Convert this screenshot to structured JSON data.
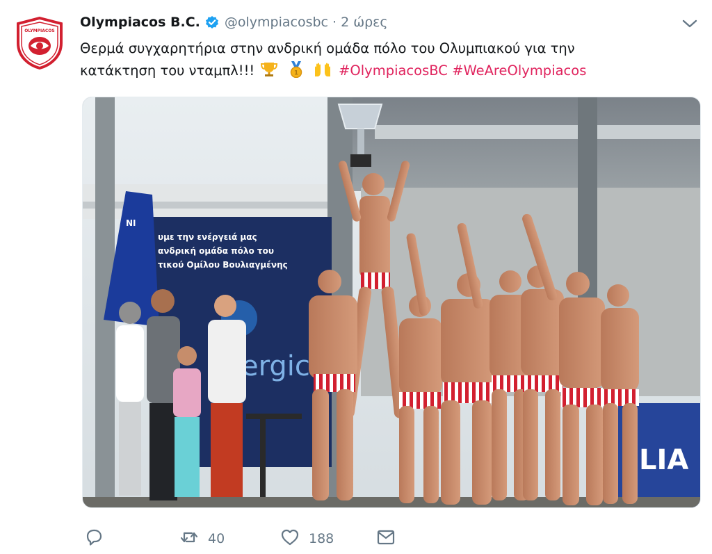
{
  "tweet": {
    "display_name": "Olympiacos B.C.",
    "handle": "@olympiacosbc",
    "separator": "·",
    "time": "2 ώρες",
    "text_line1": "Θερμά συγχαρητήρια στην ανδρική ομάδα πόλο του Ολυμπιακού για την",
    "text_line2": "κατάκτηση του νταμπλ!!!",
    "emojis": [
      "trophy-emoji",
      "gold-medal-emoji",
      "raised-hands-emoji"
    ],
    "hashtags": [
      "#OlympiacosBC",
      "#WeAreOlympiacos"
    ]
  },
  "photo": {
    "banner_line1": "υμε την ενέργειά μας",
    "banner_line2": "ανδρική ομάδα πόλο του",
    "banner_line3": "τικού Ομίλου Βουλιαγμένης",
    "banner_brand": "ergic",
    "board_text": "LIA",
    "board_left_text": "NI"
  },
  "actions": {
    "reply_icon": "reply-icon",
    "retweet_count": "40",
    "like_count": "188",
    "dm_icon": "envelope-icon"
  },
  "colors": {
    "brand_red": "#d22030",
    "hashtag": "#e0245e",
    "verified_blue": "#1da1f2",
    "muted": "#657786",
    "banner_navy": "#1c2f62"
  }
}
